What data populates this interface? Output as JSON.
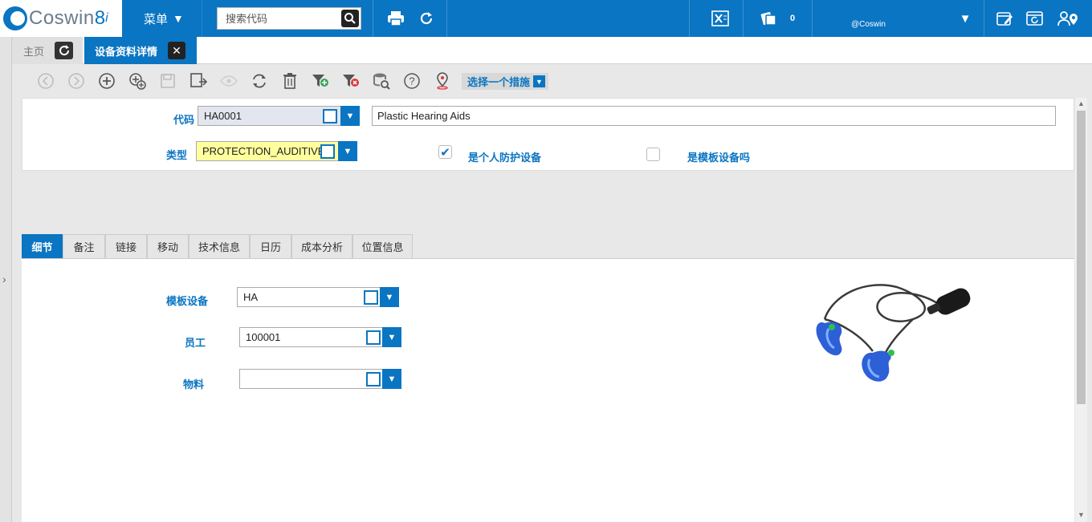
{
  "app": {
    "logo_text": "Coswin",
    "logo_version": "8",
    "logo_suffix": "i",
    "menu_label": "菜单",
    "search_placeholder": "搜索代码",
    "notification_count": "0",
    "user_label": "@Coswin"
  },
  "tabs": {
    "home_label": "主页",
    "active_label": "设备资料详情"
  },
  "toolbar": {
    "action_select_label": "选择一个措施"
  },
  "header": {
    "code_label": "代码",
    "code_value": "HA0001",
    "description_value": "Plastic Hearing Aids",
    "type_label": "类型",
    "type_value": "PROTECTION_AUDITIVE",
    "ppe_label": "是个人防护设备",
    "ppe_checked": true,
    "template_label": "是模板设备吗",
    "template_checked": false
  },
  "detail_tabs": [
    "细节",
    "备注",
    "链接",
    "移动",
    "技术信息",
    "日历",
    "成本分析",
    "位置信息"
  ],
  "detail": {
    "template_equipment_label": "模板设备",
    "template_equipment_value": "HA",
    "employee_label": "员工",
    "employee_value": "100001",
    "material_label": "物料",
    "material_value": ""
  },
  "colors": {
    "brand_blue": "#0a75c2",
    "type_field_bg": "#ffff9e",
    "code_field_bg": "#e3e6ee"
  }
}
